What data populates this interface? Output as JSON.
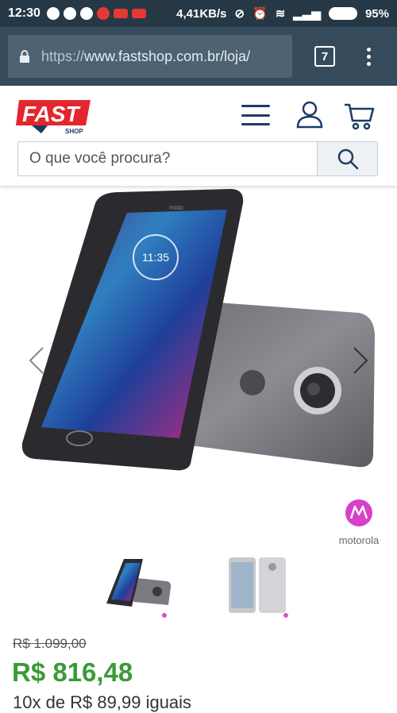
{
  "status_bar": {
    "time": "12:30",
    "network_speed": "4,41KB/s",
    "battery": "95%"
  },
  "browser": {
    "url_scheme": "https://",
    "url_rest": "www.fastshop.com.br/loja/",
    "tab_count": "7"
  },
  "site": {
    "search_placeholder": "O que você procura?",
    "logo_label": "FAST",
    "logo_sublabel": "SHOP"
  },
  "product": {
    "brand": "motorola",
    "phone_screen_time": "11:35",
    "phone_brand_mark": "moto",
    "old_price": "R$ 1.099,00",
    "price": "R$ 816,48",
    "installments": "10x de R$ 89,99 iguais"
  },
  "colors": {
    "status_bar": "#263845",
    "browser_bar": "#354b5c",
    "price_green": "#3a9b35",
    "logo_red": "#e3262d",
    "nav_blue": "#1c3c66",
    "brand_pink": "#d93fc9"
  }
}
